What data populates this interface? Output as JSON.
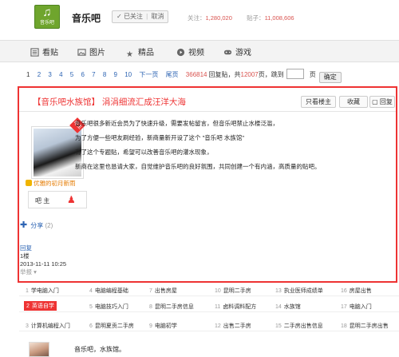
{
  "header": {
    "logo_text": "音乐吧",
    "bar_name": "音乐吧",
    "follow_label": "已关注",
    "unfollow_label": "取消",
    "follow_count_label": "关注：",
    "follow_count": "1,280,020",
    "post_count_label": "贴子：",
    "post_count": "11,008,606"
  },
  "nav": {
    "items": [
      {
        "label": "看贴",
        "icon": "list-icon"
      },
      {
        "label": "图片",
        "icon": "image-icon"
      },
      {
        "label": "精品",
        "icon": "star-icon"
      },
      {
        "label": "视频",
        "icon": "video-icon"
      },
      {
        "label": "游戏",
        "icon": "gamepad-icon"
      }
    ]
  },
  "pager": {
    "pages": [
      "1",
      "2",
      "3",
      "4",
      "5",
      "6",
      "7",
      "8",
      "9",
      "10"
    ],
    "next": "下一页",
    "last": "尾页",
    "reply_count": "366814",
    "reply_label": "回复贴，共",
    "total_pages": "12007",
    "pages_label": "页，跳到",
    "page_unit": "页",
    "go": "确定"
  },
  "post": {
    "title": "【音乐吧水族馆】 涓涓细流汇成汪洋大海",
    "only_owner": "只看楼主",
    "collect": "收藏",
    "reply_btn": "回复",
    "corner_tag": "吧主",
    "badge": "优雅的初月新雨",
    "role": "吧 主",
    "share_label": "分享",
    "share_count": "(2)",
    "paragraphs": [
      "音乐吧很多新近会员为了快速升级，需要发帖留言，但音乐吧禁止水楼泛滥，",
      "为了方便一些吧友刷经验，新商量新开设了这个 \"音乐吧 水族馆\"",
      "有了这个专题贴，希望可以改善音乐吧的灌水现象，",
      "新商在这里也恳请大家，自觉维护音乐吧的良好氛围，共同创建一个有内涵，高质量的贴吧。"
    ],
    "reply_link": "回复",
    "floor": "1楼",
    "datetime": "2013-11-11 10:25",
    "report": "举报"
  },
  "footer_links": [
    {
      "n": "1",
      "label": "学电脑入门"
    },
    {
      "n": "4",
      "label": "电脑编程基础"
    },
    {
      "n": "7",
      "label": "出售房屋"
    },
    {
      "n": "10",
      "label": "昆明二手房"
    },
    {
      "n": "13",
      "label": "执业医师成绩单"
    },
    {
      "n": "16",
      "label": "房屋出售"
    },
    {
      "n": "2",
      "label": "英语自学"
    },
    {
      "n": "5",
      "label": "电脑技巧入门"
    },
    {
      "n": "8",
      "label": "昆明二手房信息"
    },
    {
      "n": "11",
      "label": "卤料调料配方"
    },
    {
      "n": "14",
      "label": "水族馆"
    },
    {
      "n": "17",
      "label": "电脑入门"
    },
    {
      "n": "3",
      "label": "计算机编程入门"
    },
    {
      "n": "6",
      "label": "昆明夏贡二手房"
    },
    {
      "n": "9",
      "label": "电脑初学"
    },
    {
      "n": "12",
      "label": "出售二手房"
    },
    {
      "n": "15",
      "label": "二手房出售信息"
    },
    {
      "n": "18",
      "label": "昆明二手房出售"
    }
  ],
  "bottom": {
    "text": "音乐吧，水族馆。"
  }
}
